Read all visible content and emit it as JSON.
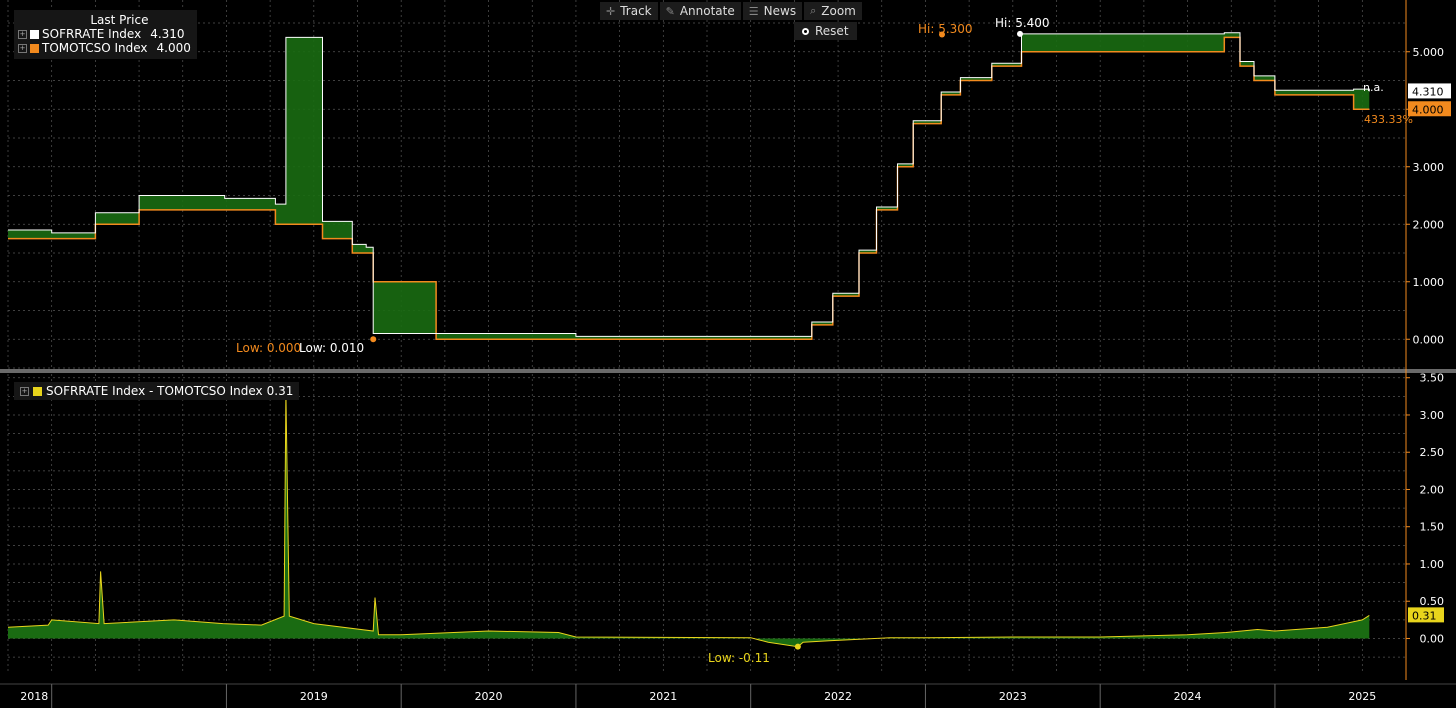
{
  "toolbar": {
    "track": "Track",
    "annotate": "Annotate",
    "news": "News",
    "zoom": "Zoom",
    "reset": "Reset"
  },
  "colors": {
    "sofr": "#ffffff",
    "tomo": "#f28a1e",
    "spread": "#e8d41c",
    "fill": "#1a6b12",
    "grid": "#555555",
    "axis": "#f28a1e"
  },
  "legend": {
    "header": "Last Price",
    "items": [
      {
        "name": "SOFRRATE Index",
        "value": "4.310"
      },
      {
        "name": "TOMOTCSO Index",
        "value": "4.000"
      }
    ]
  },
  "legend2": {
    "name": "SOFRRATE Index - TOMOTCSO Index",
    "value": "0.31"
  },
  "annotations": {
    "top_hi_orange": "Hi: 5.300",
    "top_hi_white": "Hi: 5.400",
    "top_low_orange": "Low: 0.000",
    "top_low_white": "Low: 0.010",
    "na": "n.a.",
    "sofr_last": "4.310",
    "tomo_last": "4.000",
    "pct": "433.33%",
    "spread_low": "Low: -0.11",
    "spread_last": "0.31"
  },
  "chart_data": [
    {
      "type": "line",
      "ylim": [
        -0.5,
        5.9
      ],
      "yticks": [
        "0.000",
        "1.000",
        "2.000",
        "3.000",
        "4.000",
        "5.000"
      ],
      "x_tick_labels": [
        "2018",
        "2019",
        "2020",
        "2021",
        "2022",
        "2023",
        "2024",
        "2025"
      ],
      "series": [
        {
          "name": "TOMOTCSO Index",
          "x": [
            2017.75,
            2018.0,
            2018.25,
            2018.5,
            2018.99,
            2019.28,
            2019.55,
            2019.72,
            2019.8,
            2019.84,
            2020.2,
            2021.0,
            2022.2,
            2022.35,
            2022.47,
            2022.62,
            2022.72,
            2022.84,
            2022.93,
            2023.09,
            2023.2,
            2023.38,
            2023.55,
            2024.71,
            2024.8,
            2024.88,
            2025.0,
            2025.45,
            2025.54
          ],
          "values": [
            1.75,
            1.75,
            2.0,
            2.25,
            2.25,
            2.0,
            1.75,
            1.5,
            1.5,
            1.0,
            0.0,
            0.0,
            0.0,
            0.25,
            0.75,
            1.5,
            2.25,
            3.0,
            3.75,
            4.25,
            4.5,
            4.75,
            5.0,
            5.25,
            4.75,
            4.5,
            4.25,
            4.0,
            4.0
          ]
        },
        {
          "name": "SOFRRATE Index",
          "x": [
            2017.75,
            2018.0,
            2018.25,
            2018.5,
            2018.99,
            2019.28,
            2019.34,
            2019.55,
            2019.72,
            2019.8,
            2019.84,
            2020.2,
            2021.0,
            2022.2,
            2022.35,
            2022.47,
            2022.62,
            2022.72,
            2022.84,
            2022.93,
            2023.09,
            2023.2,
            2023.38,
            2023.55,
            2024.71,
            2024.8,
            2024.88,
            2025.0,
            2025.45,
            2025.54
          ],
          "values": [
            1.9,
            1.85,
            2.2,
            2.5,
            2.45,
            2.35,
            5.25,
            2.05,
            1.65,
            1.6,
            0.1,
            0.1,
            0.05,
            0.05,
            0.3,
            0.8,
            1.55,
            2.3,
            3.05,
            3.8,
            4.3,
            4.55,
            4.8,
            5.31,
            5.33,
            4.83,
            4.58,
            4.33,
            4.35,
            4.31
          ]
        }
      ]
    },
    {
      "type": "area",
      "ylim": [
        -0.45,
        3.55
      ],
      "yticks": [
        "0.00",
        "0.50",
        "1.00",
        "1.50",
        "2.00",
        "2.50",
        "3.00",
        "3.50"
      ],
      "series": [
        {
          "name": "SOFRRATE Index - TOMOTCSO Index",
          "x": [
            2017.75,
            2017.98,
            2018.0,
            2018.27,
            2018.28,
            2018.3,
            2018.7,
            2018.98,
            2019.2,
            2019.33,
            2019.34,
            2019.36,
            2019.5,
            2019.84,
            2019.85,
            2019.87,
            2020.0,
            2020.5,
            2020.9,
            2021.0,
            2022.0,
            2022.05,
            2022.1,
            2022.27,
            2022.3,
            2022.45,
            2022.8,
            2023.0,
            2023.5,
            2024.0,
            2024.5,
            2024.72,
            2024.9,
            2025.0,
            2025.3,
            2025.5,
            2025.54
          ],
          "values": [
            0.15,
            0.18,
            0.25,
            0.2,
            0.9,
            0.2,
            0.25,
            0.2,
            0.18,
            0.3,
            3.3,
            0.3,
            0.2,
            0.1,
            0.55,
            0.05,
            0.05,
            0.1,
            0.08,
            0.02,
            0.01,
            -0.02,
            -0.05,
            -0.11,
            -0.05,
            -0.03,
            0.01,
            0.01,
            0.02,
            0.02,
            0.05,
            0.08,
            0.12,
            0.1,
            0.15,
            0.25,
            0.31
          ]
        }
      ]
    }
  ]
}
